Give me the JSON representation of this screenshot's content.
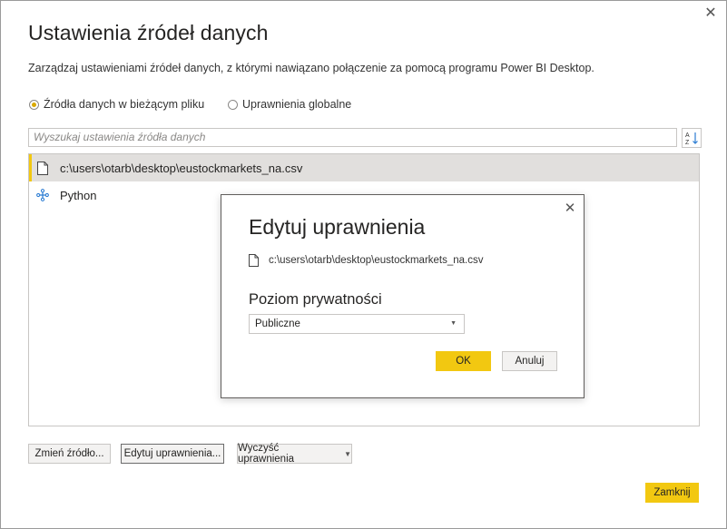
{
  "window": {
    "title": "Ustawienia źródeł danych",
    "description": "Zarządzaj ustawieniami źródeł danych, z którymi nawiązano połączenie za pomocą programu Power BI Desktop.",
    "close_icon": "close-icon"
  },
  "scope": {
    "current_file_label": "Źródła danych w bieżącym pliku",
    "global_label": "Uprawnienia globalne",
    "selected": "current_file"
  },
  "search": {
    "placeholder": "Wyszukaj ustawienia źródła danych",
    "sort_icon": "sort-az-icon"
  },
  "sources": [
    {
      "label": "c:\\users\\otarb\\desktop\\eustockmarkets_na.csv",
      "icon": "file-icon",
      "selected": true
    },
    {
      "label": "Python",
      "icon": "python-icon",
      "selected": false
    }
  ],
  "buttons": {
    "change_source": "Zmień źródło...",
    "edit_permissions": "Edytuj uprawnienia...",
    "clear_permissions": "Wyczyść uprawnienia",
    "close": "Zamknij"
  },
  "dialog": {
    "title": "Edytuj uprawnienia",
    "path": "c:\\users\\otarb\\desktop\\eustockmarkets_na.csv",
    "privacy_label": "Poziom prywatności",
    "privacy_value": "Publiczne",
    "ok": "OK",
    "cancel": "Anuluj"
  },
  "colors": {
    "accent": "#f2c811",
    "selection": "#e1dfdd",
    "border": "#c8c6c4",
    "icon_blue": "#2b7cd3"
  }
}
